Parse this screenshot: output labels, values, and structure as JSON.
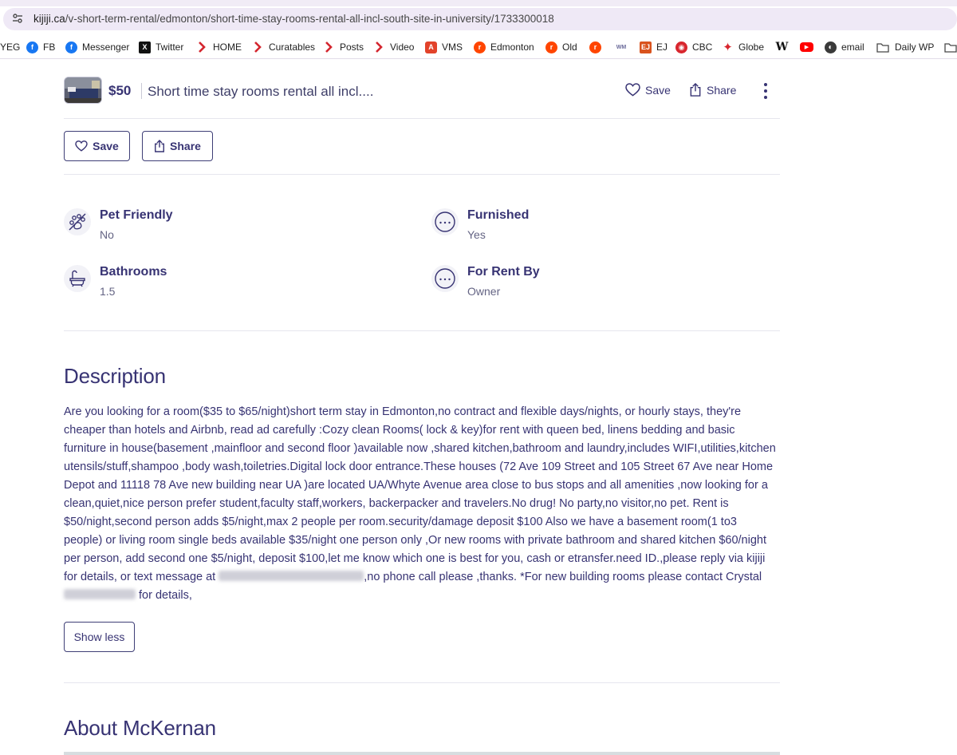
{
  "browser": {
    "url_domain": "kijiji.ca",
    "url_path": "/v-short-term-rental/edmonton/short-time-stay-rooms-rental-all-incl-south-site-in-university/1733300018",
    "bookmarks": [
      {
        "label": "YEG",
        "icon": "partial-icon"
      },
      {
        "label": "FB",
        "icon": "facebook-icon"
      },
      {
        "label": "Messenger",
        "icon": "messenger-icon"
      },
      {
        "label": "Twitter",
        "icon": "x-icon"
      },
      {
        "label": "HOME",
        "icon": "chevron-icon"
      },
      {
        "label": "Curatables",
        "icon": "chevron-icon"
      },
      {
        "label": "Posts",
        "icon": "chevron-icon"
      },
      {
        "label": "Video",
        "icon": "chevron-icon"
      },
      {
        "label": "VMS",
        "icon": "shield-icon"
      },
      {
        "label": "Edmonton",
        "icon": "reddit-icon"
      },
      {
        "label": "Old",
        "icon": "reddit-icon"
      },
      {
        "label": "",
        "icon": "reddit-icon"
      },
      {
        "label": "",
        "icon": "wm-icon"
      },
      {
        "label": "EJ",
        "icon": "ej-icon"
      },
      {
        "label": "CBC",
        "icon": "cbc-icon"
      },
      {
        "label": "Globe",
        "icon": "maple-leaf-icon"
      },
      {
        "label": "",
        "icon": "wikipedia-icon"
      },
      {
        "label": "",
        "icon": "youtube-icon"
      },
      {
        "label": "email",
        "icon": "globe-icon"
      },
      {
        "label": "Daily WP",
        "icon": "folder-icon"
      }
    ]
  },
  "header": {
    "price": "$50",
    "title": "Short time stay rooms rental all incl....",
    "save_label": "Save",
    "share_label": "Share"
  },
  "actions": {
    "save_label": "Save",
    "share_label": "Share"
  },
  "attributes": [
    {
      "label": "Pet Friendly",
      "value": "No",
      "icon": "no-pets-icon"
    },
    {
      "label": "Furnished",
      "value": "Yes",
      "icon": "dots-circle-icon"
    },
    {
      "label": "Bathrooms",
      "value": "1.5",
      "icon": "bathtub-icon"
    },
    {
      "label": "For Rent By",
      "value": "Owner",
      "icon": "dots-circle-icon"
    }
  ],
  "description": {
    "heading": "Description",
    "text_1": "Are you looking for a room($35 to $65/night)short term stay in Edmonton,no contract and flexible days/nights, or hourly stays, they're cheaper than hotels and Airbnb, read ad carefully :Cozy clean Rooms( lock & key)for rent with queen bed, linens bedding and basic furniture in house(basement ,mainfloor and second floor )available now ,shared kitchen,bathroom and laundry,includes WIFI,utilities,kitchen utensils/stuff,shampoo ,body wash,toiletries.Digital lock door entrance.These houses (72 Ave 109 Street and 105 Street 67 Ave near Home Depot and 11118 78 Ave new building near UA )are located UA/Whyte Avenue area close to bus stops and all amenities ,now looking for a clean,quiet,nice person prefer student,faculty staff,workers, backerpacker and travelers.No drug! No party,no visitor,no pet. Rent is $50/night,second person adds $5/night,max 2 people per room.security/damage deposit $100 Also we have a basement room(1 to3 people) or living room single beds available $35/night one person only ,Or new rooms with private bathroom and shared kitchen $60/night per person, add second one $5/night, deposit $100,let me know which one is best for you, cash or etransfer.need ID.,please reply via kijiji for details, or text message at ",
    "text_2": ",no phone call please ,thanks. *For new building rooms please contact Crystal ",
    "text_3": " for details,",
    "show_less_label": "Show less"
  },
  "about": {
    "heading": "About McKernan"
  }
}
